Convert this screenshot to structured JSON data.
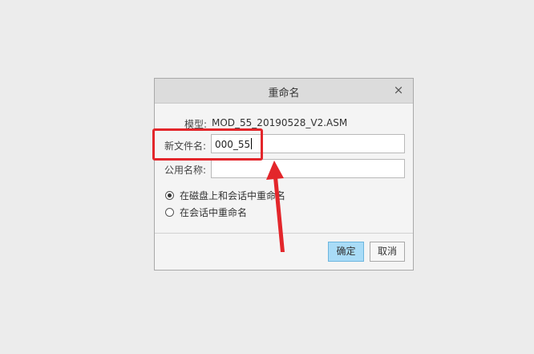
{
  "dialog": {
    "title": "重命名",
    "close_glyph": "×",
    "model_label": "模型:",
    "model_value": "MOD_55_20190528_V2.ASM",
    "new_filename_label": "新文件名:",
    "new_filename_value": "000_55",
    "common_name_label": "公用名称:",
    "common_name_value": "",
    "options": [
      {
        "label": "在磁盘上和会话中重命名",
        "checked": true
      },
      {
        "label": "在会话中重命名",
        "checked": false
      }
    ],
    "ok_label": "确定",
    "cancel_label": "取消"
  },
  "annotation": {
    "color": "#e3262b"
  },
  "colors": {
    "background": "#ececec",
    "primary_button": "#a9dcf7",
    "highlight": "#e3262b"
  }
}
